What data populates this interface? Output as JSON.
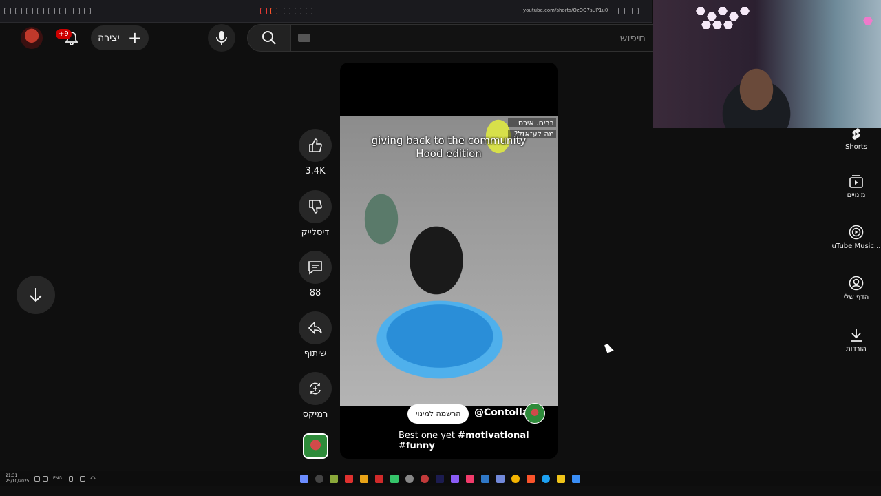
{
  "browser": {
    "url": "youtube.com/shorts/QzQQ7sUP1u0"
  },
  "header": {
    "notification_badge": "+9",
    "create_label": "יצירה",
    "search_placeholder": "חיפוש"
  },
  "actions": {
    "like_count": "3.4K",
    "dislike_label": "דיסלייק",
    "comment_count": "88",
    "share_label": "שיתוף",
    "remix_label": "רמיקס"
  },
  "video": {
    "caption_line1": "giving back to the community",
    "caption_line2": "Hood edition",
    "overlay_line1": "ברים. איכס",
    "overlay_line2": "מה לעזאזל?",
    "subscribe_label": "הרשמה למינוי",
    "channel_name": "@Contolla",
    "description_text": "Best one yet ",
    "hashtag1": "#motivational",
    "hashtag2": "#funny"
  },
  "guide": {
    "items": [
      {
        "label": "Shorts",
        "icon": "shorts-icon"
      },
      {
        "label": "מינויים",
        "icon": "subscriptions-icon"
      },
      {
        "label": "uTube Music...",
        "icon": "youtube-music-icon"
      },
      {
        "label": "הדף שלי",
        "icon": "account-icon"
      },
      {
        "label": "הורדות",
        "icon": "download-icon"
      }
    ]
  },
  "taskbar": {
    "time": "21:31",
    "date": "25/10/2025",
    "language": "ENG"
  },
  "colors": {
    "background": "#0f0f0f",
    "button_bg": "#272727",
    "badge_red": "#cc0000",
    "pool_blue": "#2a8ed8"
  }
}
